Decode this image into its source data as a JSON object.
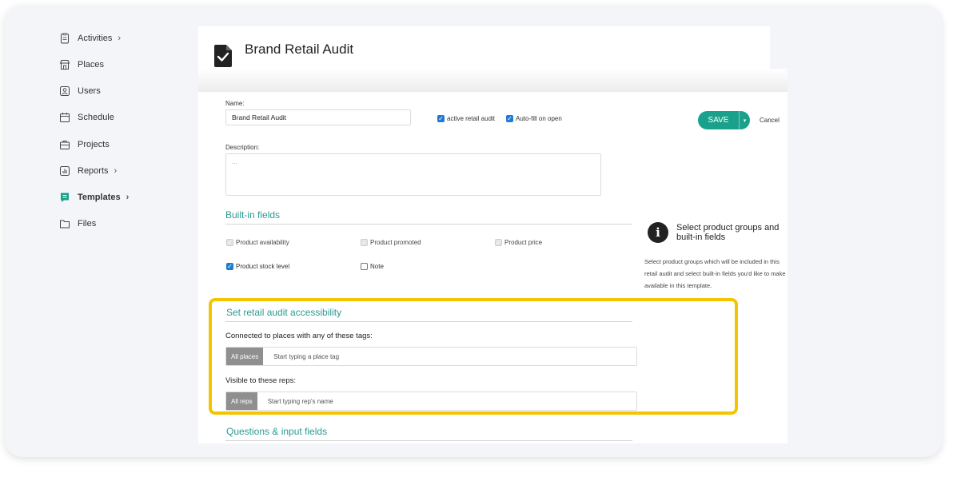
{
  "sidebar": {
    "items": [
      {
        "label": "Activities",
        "icon": "clipboard-icon",
        "chevron": "›"
      },
      {
        "label": "Places",
        "icon": "store-icon",
        "chevron": ""
      },
      {
        "label": "Users",
        "icon": "user-icon",
        "chevron": ""
      },
      {
        "label": "Schedule",
        "icon": "calendar-icon",
        "chevron": ""
      },
      {
        "label": "Projects",
        "icon": "briefcase-icon",
        "chevron": ""
      },
      {
        "label": "Reports",
        "icon": "chart-icon",
        "chevron": "›"
      },
      {
        "label": "Templates",
        "icon": "template-icon",
        "chevron": "›",
        "active": true
      },
      {
        "label": "Files",
        "icon": "folder-icon",
        "chevron": ""
      }
    ]
  },
  "header": {
    "title": "Brand Retail Audit"
  },
  "form": {
    "name_label": "Name:",
    "name_value": "Brand Retail Audit",
    "active_label": "active retail audit",
    "autofill_label": "Auto-fill on open",
    "description_label": "Description:",
    "description_value": "...",
    "save_label": "SAVE",
    "save_caret": "▾",
    "cancel_label": "Cancel"
  },
  "builtin": {
    "title": "Built-in fields",
    "fields": [
      {
        "label": "Product availability",
        "state": "disabled"
      },
      {
        "label": "Product promoted",
        "state": "disabled"
      },
      {
        "label": "Product price",
        "state": "disabled"
      },
      {
        "label": "Product stock level",
        "state": "checked"
      },
      {
        "label": "Note",
        "state": "empty"
      }
    ]
  },
  "info": {
    "icon_glyph": "i",
    "title": "Select product groups and built-in fields",
    "text": "Select product groups which will be included in this retail audit and select built-in fields you'd like to make available in this template."
  },
  "accessibility": {
    "title": "Set retail audit accessibility",
    "places_label": "Connected to places with any of these tags:",
    "places_chip": "All places",
    "places_placeholder": "Start typing a place tag",
    "reps_label": "Visible to these reps:",
    "reps_chip": "All reps",
    "reps_placeholder": "Start typing rep's name"
  },
  "questions": {
    "title": "Questions & input fields"
  },
  "colors": {
    "accent": "#1aa18b",
    "section_title": "#2a9a92",
    "highlight": "#f5c400",
    "checkbox": "#1f7ad4"
  }
}
